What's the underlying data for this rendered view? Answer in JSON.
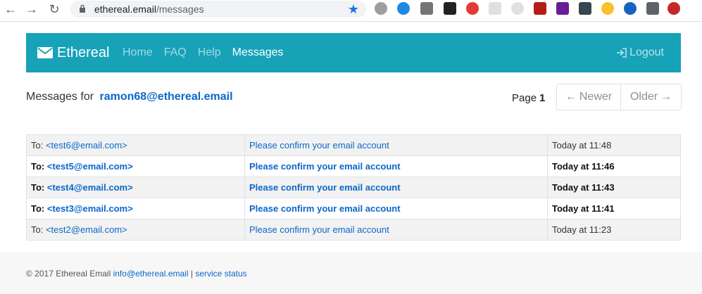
{
  "browser": {
    "url_host": "ethereal.email",
    "url_path": "/messages"
  },
  "navbar": {
    "brand": "Ethereal",
    "links": [
      "Home",
      "FAQ",
      "Help",
      "Messages"
    ],
    "active": "Messages",
    "logout": "Logout"
  },
  "messages_for": {
    "prefix": "Messages for",
    "email": "ramon68@ethereal.email"
  },
  "pager": {
    "page_label": "Page",
    "page_number": "1",
    "newer": "Newer",
    "older": "Older"
  },
  "rows": [
    {
      "to_label": "To:",
      "to": "<test6@email.com>",
      "subject": "Please confirm your email account",
      "time": "Today at 11:48",
      "unread": false
    },
    {
      "to_label": "To:",
      "to": "<test5@email.com>",
      "subject": "Please confirm your email account",
      "time": "Today at 11:46",
      "unread": true
    },
    {
      "to_label": "To:",
      "to": "<test4@email.com>",
      "subject": "Please confirm your email account",
      "time": "Today at 11:43",
      "unread": true
    },
    {
      "to_label": "To:",
      "to": "<test3@email.com>",
      "subject": "Please confirm your email account",
      "time": "Today at 11:41",
      "unread": true
    },
    {
      "to_label": "To:",
      "to": "<test2@email.com>",
      "subject": "Please confirm your email account",
      "time": "Today at 11:23",
      "unread": false
    }
  ],
  "footer": {
    "copyright": "© 2017 Ethereal Email",
    "email": "info@ethereal.email",
    "separator": "|",
    "status": "service status"
  },
  "colors": {
    "navbar": "#17a2b8",
    "link": "#0b67c9",
    "footer_bg": "#f7f7f7"
  }
}
